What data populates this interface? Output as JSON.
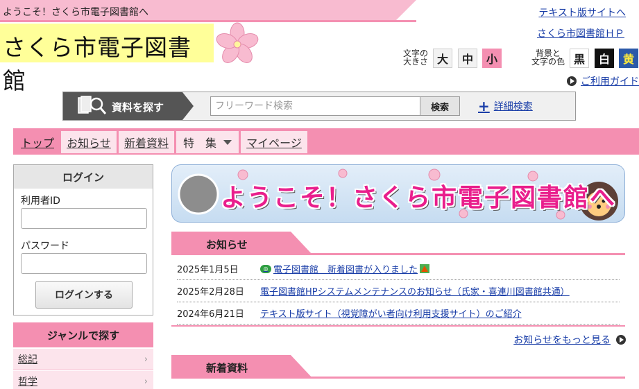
{
  "header": {
    "welcome": "ようこそ！さくら市電子図書館へ",
    "logo_text": "さくら市電子図書館",
    "text_site_link": "テキスト版サイトへ",
    "hp_link": "さくら市図書館ＨＰ",
    "font_size": {
      "label_line1": "文字の",
      "label_line2": "大きさ",
      "large": "大",
      "medium": "中",
      "small": "小",
      "selected": "小"
    },
    "bg_color": {
      "label_line1": "背景と",
      "label_line2": "文字の色",
      "black": "黒",
      "white": "白",
      "yellow": "黄"
    },
    "guide_link": "ご利用ガイド"
  },
  "search": {
    "label": "資料を探す",
    "placeholder": "フリーワード検索",
    "value": "",
    "button": "検索",
    "advanced": "詳細検索"
  },
  "nav": {
    "items": [
      {
        "label": "トップ"
      },
      {
        "label": "お知らせ"
      },
      {
        "label": "新着資料"
      },
      {
        "label": "特　集"
      },
      {
        "label": "マイページ"
      }
    ]
  },
  "login": {
    "title": "ログイン",
    "user_id_label": "利用者ID",
    "password_label": "パスワード",
    "button": "ログインする"
  },
  "genre": {
    "title": "ジャンルで探す",
    "items": [
      {
        "label": "総記"
      },
      {
        "label": "哲学"
      }
    ]
  },
  "banner": {
    "text": "ようこそ！さくら市電子図書館へ"
  },
  "news": {
    "title": "お知らせ",
    "items": [
      {
        "date": "2025年1月5日",
        "text": "電子図書館　新着図書が入りました"
      },
      {
        "date": "2025年2月28日",
        "text": "電子図書館HPシステムメンテナンスのお知らせ（氏家・喜連川図書館共通）"
      },
      {
        "date": "2024年6月21日",
        "text": "テキスト版サイト（視覚障がい者向け利用支援サイト）のご紹介"
      }
    ],
    "more": "お知らせをもっと見る"
  },
  "new_materials": {
    "title": "新着資料"
  },
  "colors": {
    "pink": "#f48fb1",
    "light_pink": "#fce4ec",
    "logo_bg": "#ffff99",
    "link": "#1a3ea8"
  }
}
